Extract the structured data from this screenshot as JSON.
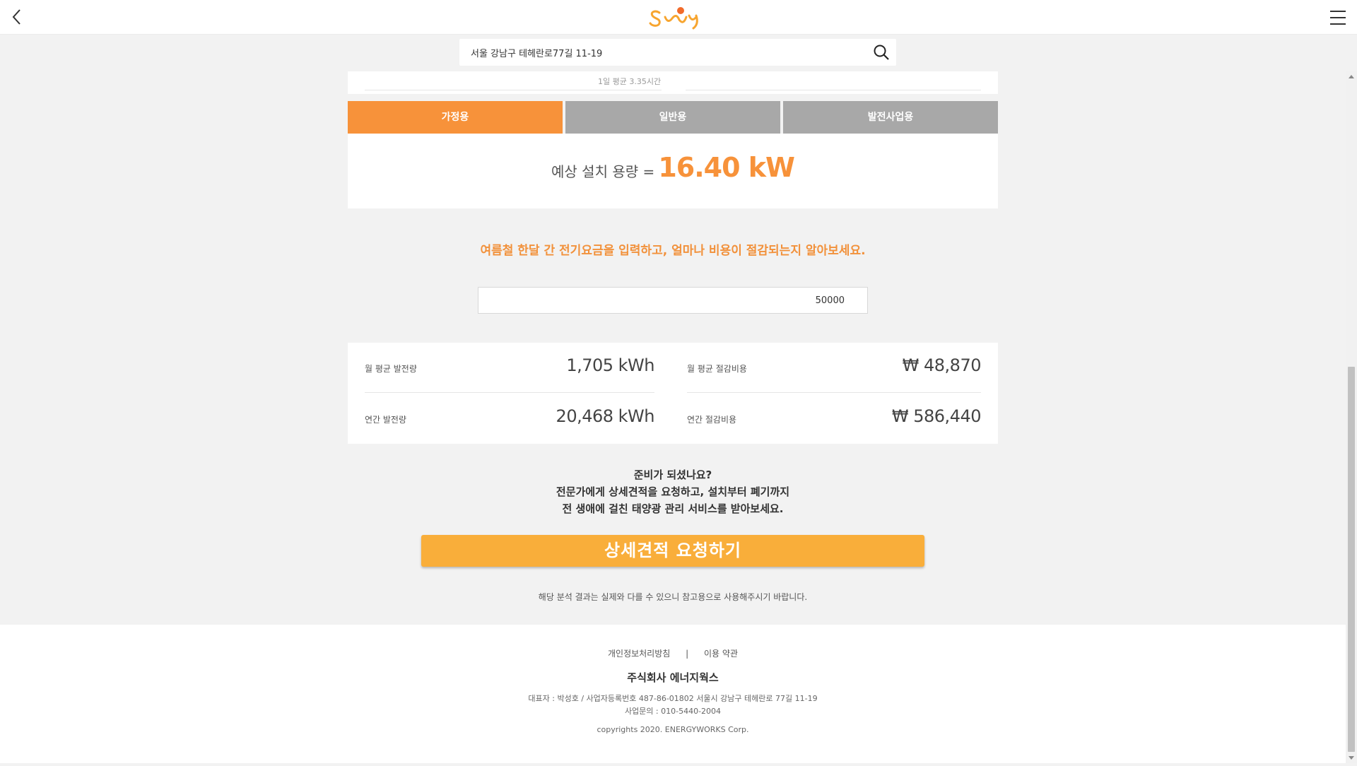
{
  "header": {
    "logo_text": "Sunny",
    "back_icon": "chevron-left-icon",
    "menu_icon": "hamburger-menu-icon"
  },
  "search": {
    "value": "서울 강남구 테헤란로77길 11-19",
    "icon": "search-icon"
  },
  "sun_hours": "1일 평균 3.35시간",
  "tabs": [
    {
      "label": "가정용",
      "active": true
    },
    {
      "label": "일반용",
      "active": false
    },
    {
      "label": "발전사업용",
      "active": false
    }
  ],
  "capacity": {
    "label": "예상 설치 용량 =",
    "value": "16.40 kW"
  },
  "prompt": "여름철 한달 간 전기요금을 입력하고, 얼마나 비용이 절감되는지 알아보세요.",
  "bill_input": {
    "value": "50000"
  },
  "stats": [
    {
      "label": "월 평균 발전량",
      "value": "1,705 kWh"
    },
    {
      "label": "월 평균 절감비용",
      "value": "₩ 48,870"
    },
    {
      "label": "연간 발전량",
      "value": "20,468 kWh"
    },
    {
      "label": "연간 절감비용",
      "value": "₩ 586,440"
    }
  ],
  "ready": {
    "line1": "준비가 되셨나요?",
    "line2": "전문가에게 상세견적을 요청하고, 설치부터 폐기까지",
    "line3": "전 생애에 걸친 태양광 관리 서비스를 받아보세요."
  },
  "cta_label": "상세견적 요청하기",
  "disclaimer": "해당 분석 결과는 실제와 다를 수 있으니 참고용으로 사용해주시기 바랍니다.",
  "footer": {
    "privacy_link": "개인정보처리방침",
    "separator": "|",
    "terms_link": "이용 약관",
    "company": "주식회사 에너지웍스",
    "info_line1": "대표자 : 박성호 / 사업자등록번호 487-86-01802 서울시 강남구 테헤란로 77길 11-19",
    "info_line2": "사업문의 : 010-5440-2004",
    "copyright": "copyrights 2020. ENERGYWORKS Corp."
  },
  "colors": {
    "accent_orange": "#f7923a",
    "cta_orange": "#f9ae3a",
    "tab_inactive": "#a8a8a8",
    "background": "#f2f2f2"
  }
}
